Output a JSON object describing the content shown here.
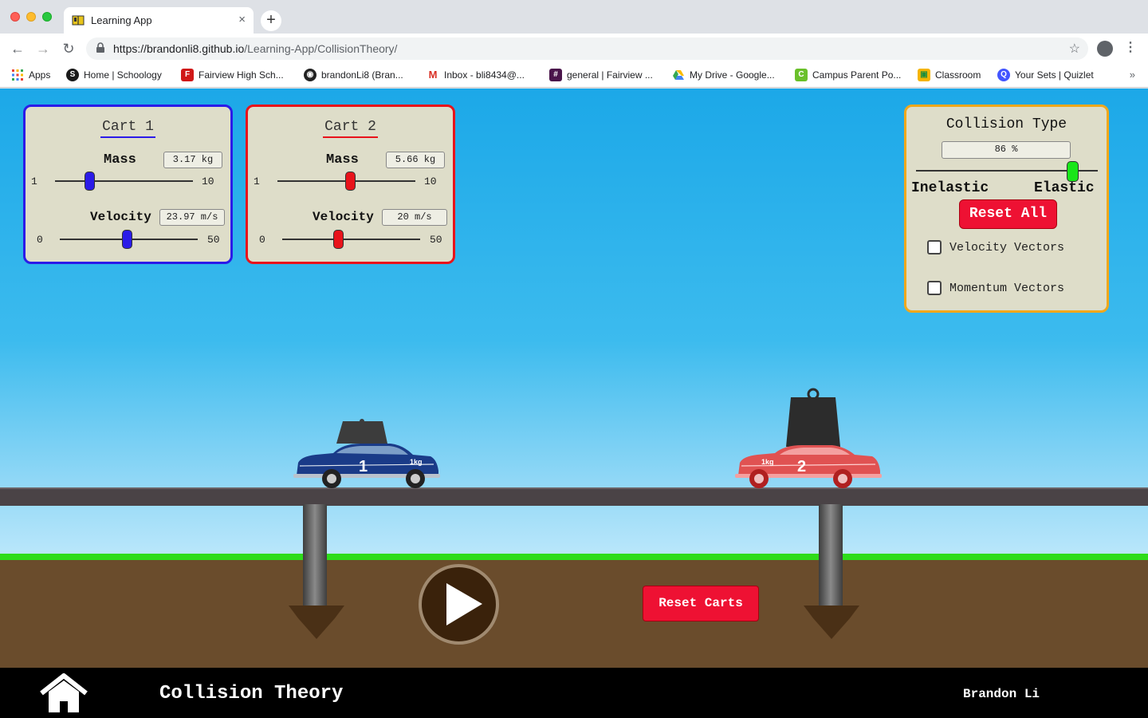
{
  "browser": {
    "tab_title": "Learning App",
    "tab_close": "×",
    "new_tab": "+",
    "url_host": "https://brandonli8.github.io",
    "url_path": "/Learning-App/CollisionTheory/",
    "bookmarks": [
      {
        "label": "Apps",
        "icon": "apps-grid-icon"
      },
      {
        "label": "Home | Schoology",
        "icon": "schoology-icon"
      },
      {
        "label": "Fairview High Sch...",
        "icon": "fairview-icon"
      },
      {
        "label": "brandonLi8 (Bran...",
        "icon": "github-icon"
      },
      {
        "label": "Inbox - bli8434@...",
        "icon": "gmail-icon"
      },
      {
        "label": "general | Fairview ...",
        "icon": "slack-icon"
      },
      {
        "label": "My Drive - Google...",
        "icon": "google-drive-icon"
      },
      {
        "label": "Campus Parent Po...",
        "icon": "campus-icon"
      },
      {
        "label": "Classroom",
        "icon": "classroom-icon"
      },
      {
        "label": "Your Sets | Quizlet",
        "icon": "quizlet-icon"
      }
    ],
    "more_bookmarks": "»"
  },
  "cart1": {
    "title": "Cart 1",
    "mass_label": "Mass",
    "mass_value": "3.17 kg",
    "mass_min": "1",
    "mass_max": "10",
    "velocity_label": "Velocity",
    "velocity_value": "23.97 m/s",
    "velocity_min": "0",
    "velocity_max": "50",
    "color": "#2b1be8",
    "mass": 3.17,
    "velocity": 23.97
  },
  "cart2": {
    "title": "Cart 2",
    "mass_label": "Mass",
    "mass_value": "5.66 kg",
    "mass_min": "1",
    "mass_max": "10",
    "velocity_label": "Velocity",
    "velocity_value": "20 m/s",
    "velocity_min": "0",
    "velocity_max": "50",
    "color": "#e8131b",
    "mass": 5.66,
    "velocity": 20
  },
  "collision": {
    "title": "Collision Type",
    "value": "86 %",
    "percent": 86,
    "inelastic_label": "Inelastic",
    "elastic_label": "Elastic",
    "reset_all": "Reset All",
    "velocity_vectors": "Velocity Vectors",
    "momentum_vectors": "Momentum Vectors",
    "thumb_color": "#19e619",
    "border_color": "#f0a81c"
  },
  "scene": {
    "car1_number": "1",
    "car1_weight_label": "1kg",
    "car2_number": "2",
    "car2_weight_label": "1kg"
  },
  "controls": {
    "reset_carts": "Reset Carts"
  },
  "footer": {
    "title": "Collision Theory",
    "author": "Brandon Li"
  }
}
